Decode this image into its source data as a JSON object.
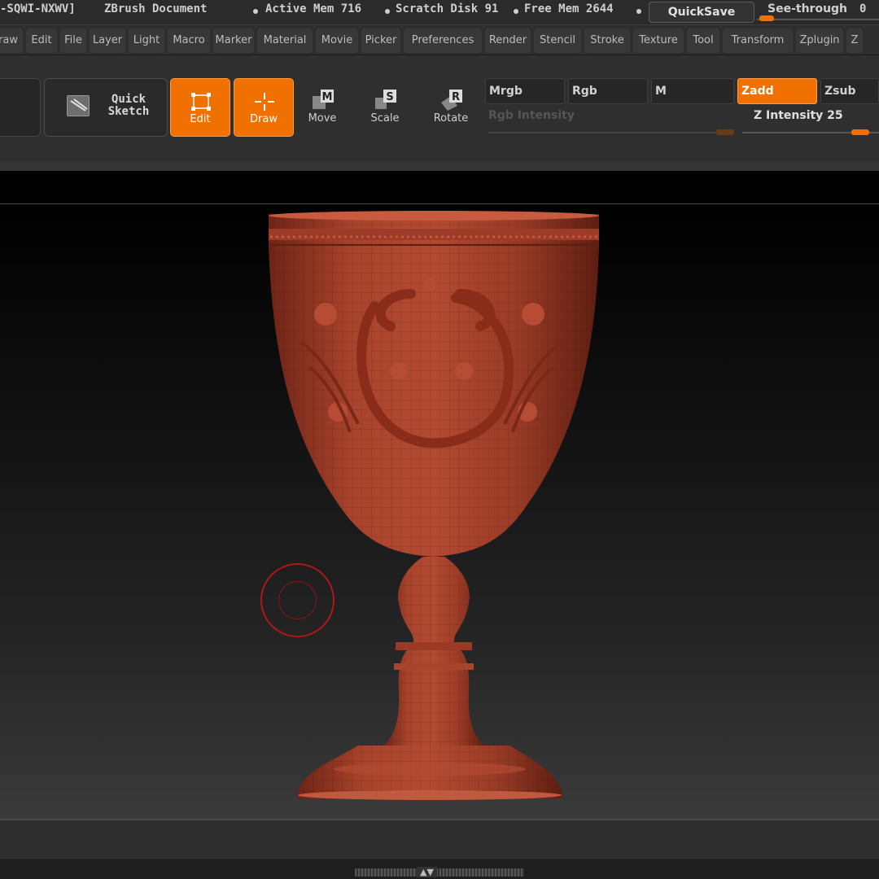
{
  "titlebar": {
    "license": "-SQWI-NXWV]",
    "document": "ZBrush Document",
    "active_mem": "Active Mem 716",
    "scratch_disk": "Scratch Disk 91",
    "free_mem": "Free Mem 2644",
    "quicksave": "QuickSave",
    "see_through_label": "See-through",
    "see_through_value": "0",
    "see_through_level": 0
  },
  "menu": [
    "raw",
    "Edit",
    "File",
    "Layer",
    "Light",
    "Macro",
    "Marker",
    "Material",
    "Movie",
    "Picker",
    "Preferences",
    "Render",
    "Stencil",
    "Stroke",
    "Texture",
    "Tool",
    "Transform",
    "Zplugin",
    "Z"
  ],
  "toolbar": {
    "quick_sketch_line1": "Quick",
    "quick_sketch_line2": "Sketch",
    "edit": "Edit",
    "draw": "Draw",
    "move": "Move",
    "scale": "Scale",
    "rotate": "Rotate",
    "move_key": "M",
    "scale_key": "S",
    "rotate_key": "R",
    "mrgb": "Mrgb",
    "rgb": "Rgb",
    "m": "M",
    "zadd": "Zadd",
    "zsub": "Zsub",
    "rgb_intensity": "Rgb Intensity",
    "z_intensity": "Z Intensity 25"
  },
  "colors": {
    "accent": "#f07000",
    "model": "#a63a26",
    "brush_ring": "#b01818"
  },
  "icons": [
    "quick-sketch-icon",
    "edit-icon",
    "draw-icon",
    "move-icon",
    "scale-icon",
    "rotate-icon",
    "brush-cursor-icon"
  ]
}
